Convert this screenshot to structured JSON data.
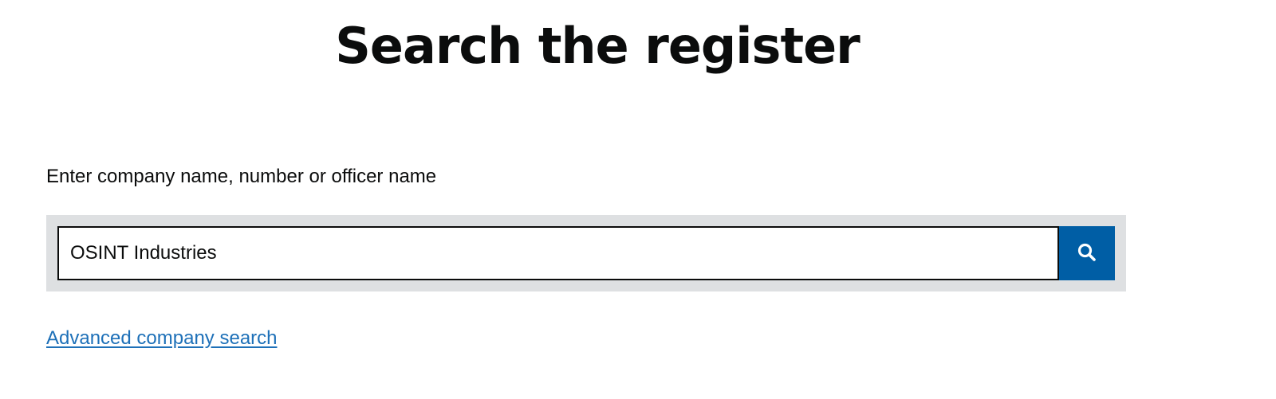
{
  "page": {
    "title": "Search the register"
  },
  "search": {
    "label": "Enter company name, number or officer name",
    "value": "OSINT Industries",
    "placeholder": "",
    "button_icon": "search-icon",
    "button_color": "#005ea5",
    "panel_color": "#dee0e2"
  },
  "links": {
    "advanced_search": "Advanced company search",
    "link_color": "#1d70b8"
  }
}
